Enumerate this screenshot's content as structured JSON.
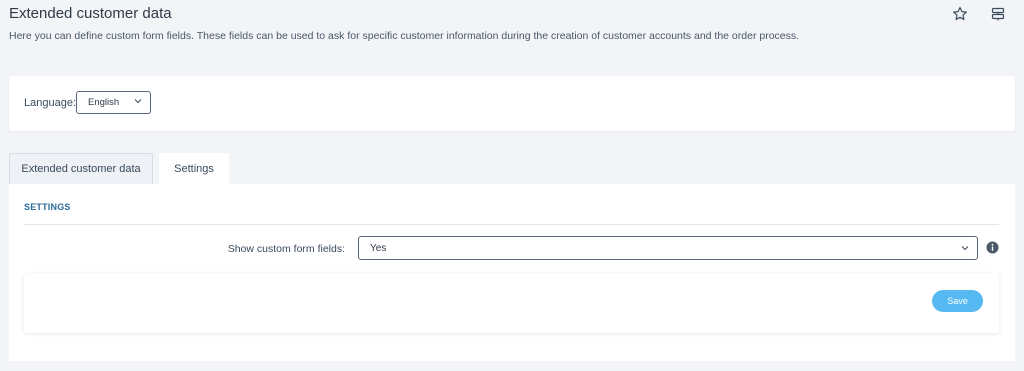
{
  "header": {
    "title": "Extended customer data",
    "description": "Here you can define custom form fields. These fields can be used to ask for specific customer information during the creation of customer accounts and the order process.",
    "icons": [
      "star-icon",
      "settings-sliders-icon"
    ]
  },
  "language": {
    "label": "Language:",
    "selected": "English"
  },
  "tabs": [
    {
      "label": "Extended customer data",
      "active": false
    },
    {
      "label": "Settings",
      "active": true
    }
  ],
  "settings": {
    "section_title": "SETTINGS",
    "show_custom_fields_label": "Show custom form fields:",
    "show_custom_fields_value": "Yes",
    "save_label": "Save"
  },
  "colors": {
    "accent": "#56b9f2",
    "section_title": "#2a6a9a",
    "background": "#f2f4f8"
  }
}
